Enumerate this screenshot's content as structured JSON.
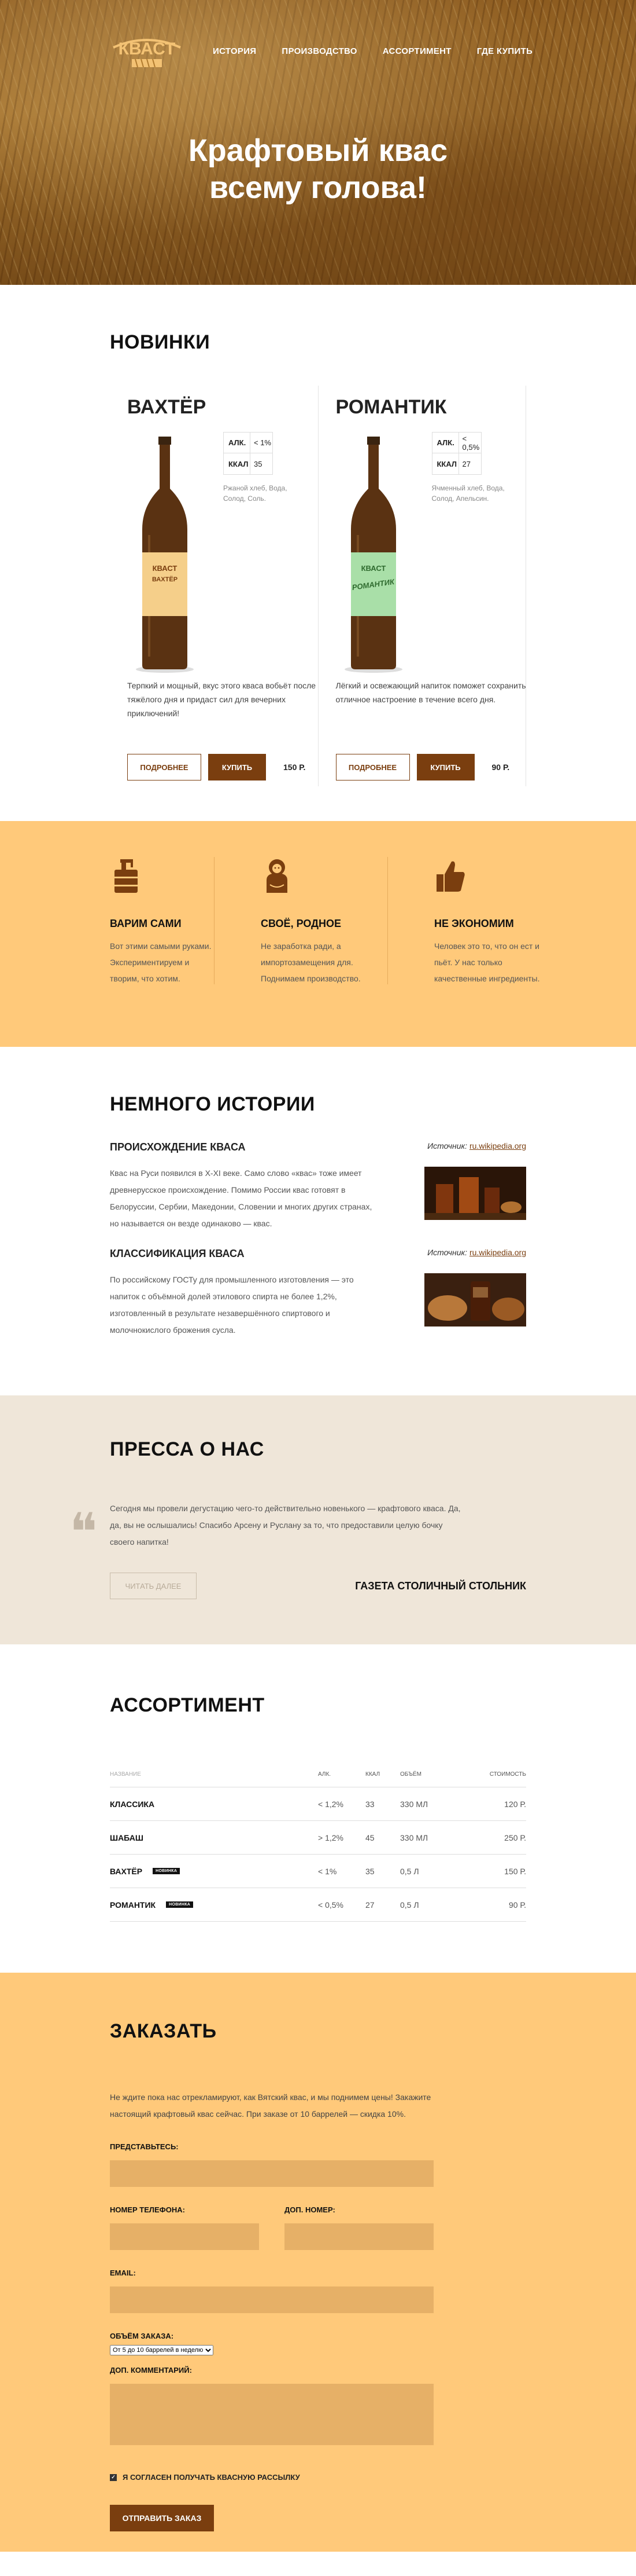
{
  "brand": {
    "logo_text": "КВАСТ"
  },
  "nav": {
    "items": [
      "ИСТОРИЯ",
      "ПРОИЗВОДСТВО",
      "АССОРТИМЕНТ",
      "ГДЕ КУПИТЬ"
    ]
  },
  "hero": {
    "title_line1": "Крафтовый квас",
    "title_line2": "всему голова!"
  },
  "new_section": {
    "title": "НОВИНКИ",
    "products": [
      {
        "name": "ВАХТЁР",
        "alc_label": "АЛК.",
        "alc": "< 1%",
        "kcal_label": "ККАЛ",
        "kcal": "35",
        "ingredients": "Ржаной хлеб, Вода, Солод, Соль.",
        "label_text": "ВАХТЁР",
        "label_color": "#f5cf8a",
        "description": "Терпкий и мощный, вкус этого кваса вобьёт после тяжёлого дня и придаст сил для вечерних приключений!",
        "more_label": "ПОДРОБНЕЕ",
        "buy_label": "КУПИТЬ",
        "price": "150 Р."
      },
      {
        "name": "РОМАНТИК",
        "alc_label": "АЛК.",
        "alc": "< 0,5%",
        "kcal_label": "ККАЛ",
        "kcal": "27",
        "ingredients": "Ячменный хлеб, Вода, Солод, Апельсин.",
        "label_text": "РОМАНТИК",
        "label_color": "#a9dfa8",
        "description": "Лёгкий и освежающий напиток поможет сохранить отличное настроение в течение всего дня.",
        "more_label": "ПОДРОБНЕЕ",
        "buy_label": "КУПИТЬ",
        "price": "90 Р."
      }
    ]
  },
  "features": [
    {
      "icon": "keg-icon",
      "title": "ВАРИМ САМИ",
      "text": "Вот этими самыми руками. Экспериментируем и творим, что хотим."
    },
    {
      "icon": "matryoshka-icon",
      "title": "СВОЁ, РОДНОЕ",
      "text": "Не заработка ради, а импортозамещения для. Поднимаем производство."
    },
    {
      "icon": "thumbs-up-icon",
      "title": "НЕ ЭКОНОМИМ",
      "text": "Человек это то, что он ест и пьёт. У нас только качественные ингредиенты."
    }
  ],
  "history": {
    "title": "НЕМНОГО ИСТОРИИ",
    "items": [
      {
        "title": "ПРОИСХОЖДЕНИЕ КВАСА",
        "source_label": "Источник:",
        "source_link": "ru.wikipedia.org",
        "text": "Квас на Руси появился в X-XI веке. Само слово «квас» тоже имеет древнерусское происхождение. Помимо России квас готовят в Белоруссии, Сербии, Македонии, Словении и многих других странах, но называется он везде одинаково — квас."
      },
      {
        "title": "КЛАССИФИКАЦИЯ КВАСА",
        "source_label": "Источник:",
        "source_link": "ru.wikipedia.org",
        "text": "По российскому ГОСТу для промышленного изготовления — это напиток с объёмной долей этилового спирта не более 1,2%, изготовленный в результате незавершённого спиртового и молочнокислого брожения сусла."
      }
    ]
  },
  "press": {
    "title": "ПРЕССА О НАС",
    "quote": "Сегодня мы провели дегустацию чего-то действительно новенького — крафтового кваса. Да, да, вы не ослышались! Спасибо Арсену и Руслану за то, что предоставили целую бочку своего напитка!",
    "read_more_label": "ЧИТАТЬ ДАЛЕЕ",
    "source": "ГАЗЕТА СТОЛИЧНЫЙ СТОЛЬНИК"
  },
  "assortment": {
    "title": "АССОРТИМЕНТ",
    "headers": [
      "НАЗВАНИЕ",
      "АЛК.",
      "ККАЛ",
      "ОБЪЁМ",
      "СТОИМОСТЬ"
    ],
    "rows": [
      {
        "name": "КЛАССИКА",
        "tag": "",
        "alc": "< 1,2%",
        "kcal": "33",
        "volume": "330 МЛ",
        "price": "120 Р."
      },
      {
        "name": "ШАБАШ",
        "tag": "",
        "alc": "> 1,2%",
        "kcal": "45",
        "volume": "330 МЛ",
        "price": "250 Р."
      },
      {
        "name": "ВАХТЁР",
        "tag": "НОВИНКА",
        "alc": "< 1%",
        "kcal": "35",
        "volume": "0,5 Л",
        "price": "150 Р."
      },
      {
        "name": "РОМАНТИК",
        "tag": "НОВИНКА",
        "alc": "< 0,5%",
        "kcal": "27",
        "volume": "0,5 Л",
        "price": "90 Р."
      }
    ]
  },
  "order": {
    "title": "ЗАКАЗАТЬ",
    "intro": "Не ждите пока нас отрекламируют, как Вятский квас, и мы поднимем цены! Закажите настоящий крафтовый квас сейчас. При заказе от 10 баррелей — скидка 10%.",
    "name_label": "ПРЕДСТАВЬТЕСЬ:",
    "phone_label": "НОМЕР ТЕЛЕФОНА:",
    "extra_phone_label": "ДОП. НОМЕР:",
    "email_label": "EMAIL:",
    "volume_label": "ОБЪЁМ ЗАКАЗА:",
    "volume_selected": "От 5 до 10 баррелей в неделю",
    "comment_label": "ДОП. КОММЕНТАРИЙ:",
    "subscribe_label": "Я СОГЛАСЕН ПОЛУЧАТЬ КВАСНУЮ РАССЫЛКУ",
    "subscribed": true,
    "submit_label": "ОТПРАВИТЬ ЗАКАЗ"
  }
}
